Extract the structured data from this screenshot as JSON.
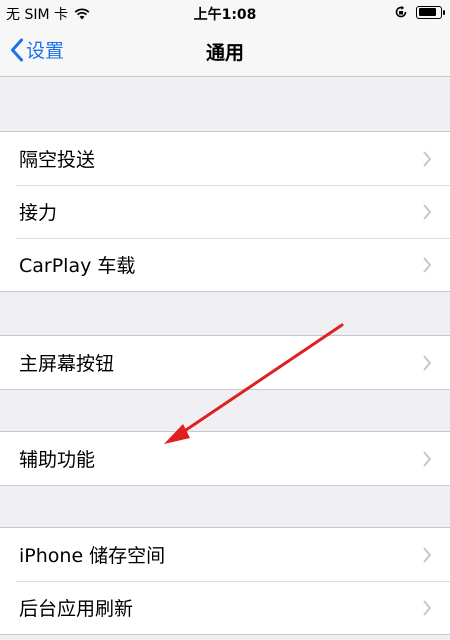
{
  "status_bar": {
    "carrier": "无 SIM 卡",
    "time": "上午1:08",
    "battery_level": 0.85
  },
  "nav": {
    "back_label": "设置",
    "title": "通用"
  },
  "groups": [
    [
      "隔空投送",
      "接力",
      "CarPlay 车载"
    ],
    [
      "主屏幕按钮"
    ],
    [
      "辅助功能"
    ],
    [
      "iPhone 储存空间",
      "后台应用刷新"
    ]
  ],
  "annotation": {
    "color": "#e02020"
  }
}
